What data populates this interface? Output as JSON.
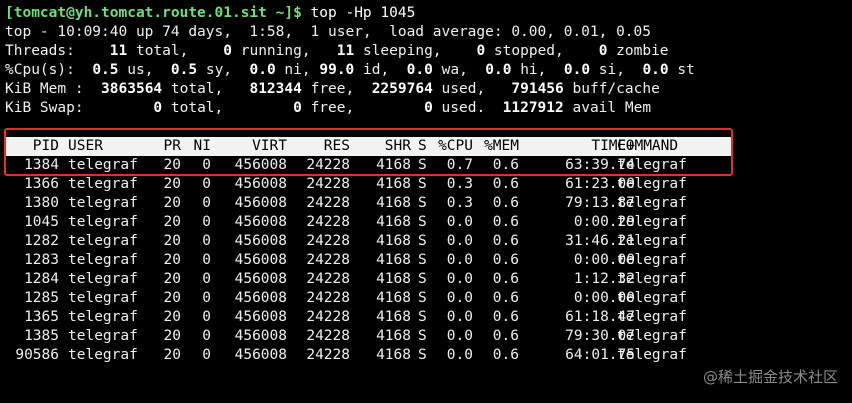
{
  "prompt": {
    "user_host": "[tomcat@yh.tomcat.route.01.sit ~]$",
    "command": " top -Hp 1045"
  },
  "summary": {
    "uptime_line": "top - 10:09:40 up 74 days,  1:58,  1 user,  load average: 0.00, 0.01, 0.05",
    "threads": {
      "label": "Threads:",
      "total": "11",
      "running": "0",
      "sleeping": "11",
      "stopped": "0",
      "zombie": "0"
    },
    "cpu": {
      "label": "%Cpu(s):",
      "us": "0.5",
      "sy": "0.5",
      "ni": "0.0",
      "id": "99.0",
      "wa": "0.0",
      "hi": "0.0",
      "si": "0.0",
      "st": "0.0"
    },
    "mem": {
      "label": "KiB Mem :",
      "total": "3863564",
      "free": "812344",
      "used": "2259764",
      "buff_cache": "791456"
    },
    "swap": {
      "label": "KiB Swap:",
      "total": "0",
      "free": "0",
      "used": "0",
      "avail_mem": "1127912"
    }
  },
  "table": {
    "headers": {
      "pid": "PID",
      "user": "USER",
      "pr": "PR",
      "ni": "NI",
      "virt": "VIRT",
      "res": "RES",
      "shr": "SHR",
      "s": "S",
      "cpu": "%CPU",
      "mem": "%MEM",
      "time": "TIME+",
      "command": "COMMAND"
    },
    "rows": [
      {
        "pid": "1384",
        "user": "telegraf",
        "pr": "20",
        "ni": "0",
        "virt": "456008",
        "res": "24228",
        "shr": "4168",
        "s": "S",
        "cpu": "0.7",
        "mem": "0.6",
        "time": "63:39.74",
        "command": "telegraf"
      },
      {
        "pid": "1366",
        "user": "telegraf",
        "pr": "20",
        "ni": "0",
        "virt": "456008",
        "res": "24228",
        "shr": "4168",
        "s": "S",
        "cpu": "0.3",
        "mem": "0.6",
        "time": "61:23.00",
        "command": "telegraf"
      },
      {
        "pid": "1380",
        "user": "telegraf",
        "pr": "20",
        "ni": "0",
        "virt": "456008",
        "res": "24228",
        "shr": "4168",
        "s": "S",
        "cpu": "0.3",
        "mem": "0.6",
        "time": "79:13.87",
        "command": "telegraf"
      },
      {
        "pid": "1045",
        "user": "telegraf",
        "pr": "20",
        "ni": "0",
        "virt": "456008",
        "res": "24228",
        "shr": "4168",
        "s": "S",
        "cpu": "0.0",
        "mem": "0.6",
        "time": "0:00.29",
        "command": "telegraf"
      },
      {
        "pid": "1282",
        "user": "telegraf",
        "pr": "20",
        "ni": "0",
        "virt": "456008",
        "res": "24228",
        "shr": "4168",
        "s": "S",
        "cpu": "0.0",
        "mem": "0.6",
        "time": "31:46.21",
        "command": "telegraf"
      },
      {
        "pid": "1283",
        "user": "telegraf",
        "pr": "20",
        "ni": "0",
        "virt": "456008",
        "res": "24228",
        "shr": "4168",
        "s": "S",
        "cpu": "0.0",
        "mem": "0.6",
        "time": "0:00.00",
        "command": "telegraf"
      },
      {
        "pid": "1284",
        "user": "telegraf",
        "pr": "20",
        "ni": "0",
        "virt": "456008",
        "res": "24228",
        "shr": "4168",
        "s": "S",
        "cpu": "0.0",
        "mem": "0.6",
        "time": "1:12.32",
        "command": "telegraf"
      },
      {
        "pid": "1285",
        "user": "telegraf",
        "pr": "20",
        "ni": "0",
        "virt": "456008",
        "res": "24228",
        "shr": "4168",
        "s": "S",
        "cpu": "0.0",
        "mem": "0.6",
        "time": "0:00.00",
        "command": "telegraf"
      },
      {
        "pid": "1365",
        "user": "telegraf",
        "pr": "20",
        "ni": "0",
        "virt": "456008",
        "res": "24228",
        "shr": "4168",
        "s": "S",
        "cpu": "0.0",
        "mem": "0.6",
        "time": "61:18.47",
        "command": "telegraf"
      },
      {
        "pid": "1385",
        "user": "telegraf",
        "pr": "20",
        "ni": "0",
        "virt": "456008",
        "res": "24228",
        "shr": "4168",
        "s": "S",
        "cpu": "0.0",
        "mem": "0.6",
        "time": "79:30.07",
        "command": "telegraf"
      },
      {
        "pid": "90586",
        "user": "telegraf",
        "pr": "20",
        "ni": "0",
        "virt": "456008",
        "res": "24228",
        "shr": "4168",
        "s": "S",
        "cpu": "0.0",
        "mem": "0.6",
        "time": "64:01.75",
        "command": "telegraf"
      }
    ]
  },
  "highlight": {
    "color": "#e0302a"
  },
  "watermark": "@稀土掘金技术社区"
}
